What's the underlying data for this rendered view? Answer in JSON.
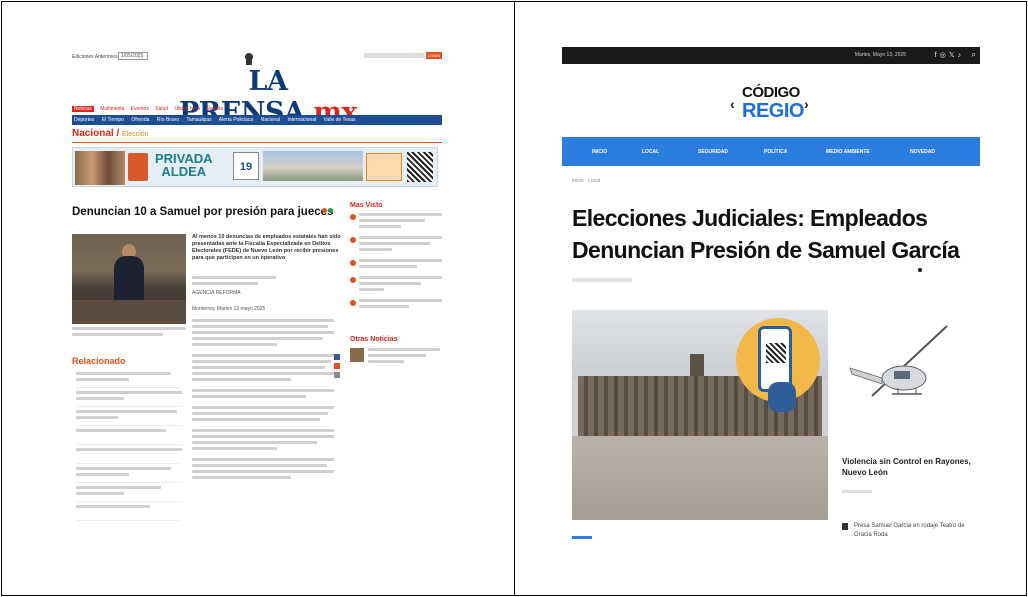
{
  "left_panel": {
    "site": {
      "logo_main": "LA PRENSA",
      "logo_tld": ".mx",
      "edition_label": "Ediciones Anteriores",
      "edition_value": "1/05/2025",
      "login_label": "LOGIN"
    },
    "subnav": [
      "Noticias",
      "Multimedia",
      "Eventos",
      "Salud",
      "Última hora",
      "Revista"
    ],
    "mainnav": [
      "Deportes",
      "El Tiempo",
      "Ofrenda",
      "Río Bravo",
      "Tamaulipas",
      "Alerta Policiaca",
      "Nacional",
      "Internacional",
      "Valle de Texas"
    ],
    "section": {
      "title": "Nacional",
      "sub": "Elección"
    },
    "ad": {
      "text_line1": "PRIVADA",
      "text_line2": "ALDEA",
      "number": "19"
    },
    "article": {
      "headline": "Denuncian 10 a Samuel por presión para jueces",
      "lead": "Al menos 10 denuncias de empleados estatales han sido presentadas ante la Fiscalía Especializada en Delitos Electorales (FEDE) de Nuevo León por recibir presiones para que participen en un operativo",
      "agency": "AGENCIA REFORMA",
      "dateline": "Monterrey, Martes 13 mayo 2025"
    },
    "sidebar": {
      "title": "Mas Visto",
      "items_count": 5,
      "other_title": "Otras Noticias"
    },
    "related": {
      "title": "Relacionado"
    }
  },
  "right_panel": {
    "site": {
      "logo_line1": "CÓDIGO",
      "logo_line2": "REGIO",
      "date": "Martes, Mayo 13, 2025",
      "social_icons": [
        "facebook-icon",
        "instagram-icon",
        "x-icon",
        "tiktok-icon"
      ],
      "search_icon": "search-icon"
    },
    "nav": [
      "INICIO",
      "LOCAL",
      "SEGURIDAD",
      "POLÍTICA",
      "MEDIO AMBIENTE",
      "NOVEDAD"
    ],
    "breadcrumb": "Inicio › Local",
    "article": {
      "title": "Elecciones Judiciales: Empleados Denuncian Presión de Samuel García"
    },
    "sidebar": {
      "story1_title": "Violencia sin Control en Rayones, Nuevo León",
      "story2_title": "Presa Samuel García en rodaje Teatro de Gracia Roda"
    },
    "colors": {
      "nav_blue": "#2b7de0",
      "logo_blue": "#1b6fd6",
      "lp_blue": "#0d3a7a",
      "lp_red": "#d8281c"
    }
  }
}
